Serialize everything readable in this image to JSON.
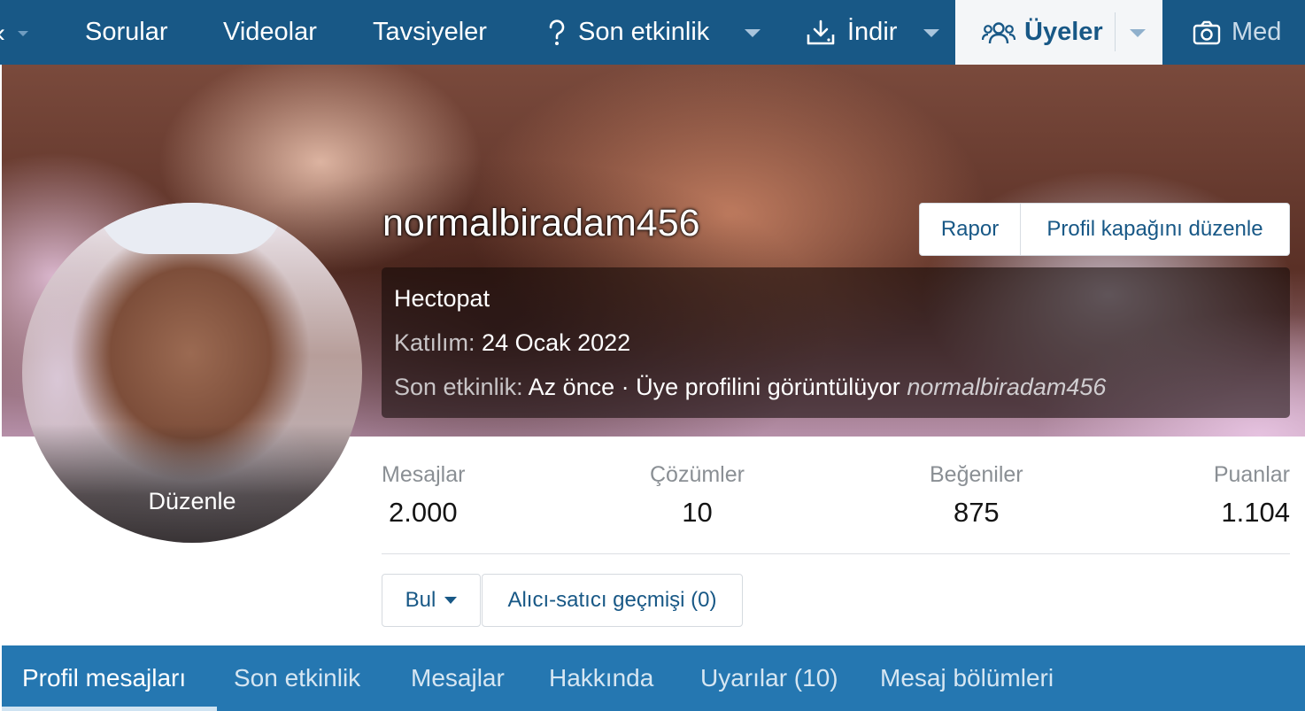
{
  "nav": {
    "items": [
      {
        "label": "Sorular"
      },
      {
        "label": "Videolar"
      },
      {
        "label": "Tavsiyeler"
      },
      {
        "label": "Son etkinlik",
        "icon": "question-icon"
      },
      {
        "label": "İndir",
        "icon": "download-icon"
      },
      {
        "label": "Üyeler",
        "icon": "users-icon",
        "active": true
      },
      {
        "label": "Med",
        "icon": "camera-icon"
      }
    ]
  },
  "profile": {
    "username": "normalbiradam456",
    "title": "Hectopat",
    "joined_label": "Katılım:",
    "joined_value": "24 Ocak 2022",
    "activity_label": "Son etkinlik:",
    "activity_value": "Az önce · Üye profilini görüntülüyor",
    "activity_target": "normalbiradam456",
    "avatar_edit_label": "Düzenle"
  },
  "buttons": {
    "report": "Rapor",
    "edit_cover": "Profil kapağını düzenle",
    "find": "Bul",
    "trader_history": "Alıcı-satıcı geçmişi (0)"
  },
  "stats": [
    {
      "label": "Mesajlar",
      "value": "2.000"
    },
    {
      "label": "Çözümler",
      "value": "10"
    },
    {
      "label": "Beğeniler",
      "value": "875"
    },
    {
      "label": "Puanlar",
      "value": "1.104"
    }
  ],
  "tabs": [
    {
      "label": "Profil mesajları",
      "active": true
    },
    {
      "label": "Son etkinlik"
    },
    {
      "label": "Mesajlar"
    },
    {
      "label": "Hakkında"
    },
    {
      "label": "Uyarılar (10)"
    },
    {
      "label": "Mesaj bölümleri"
    }
  ],
  "colors": {
    "nav_bg": "#185886",
    "tab_bg": "#2577b1",
    "accent": "#185886"
  }
}
